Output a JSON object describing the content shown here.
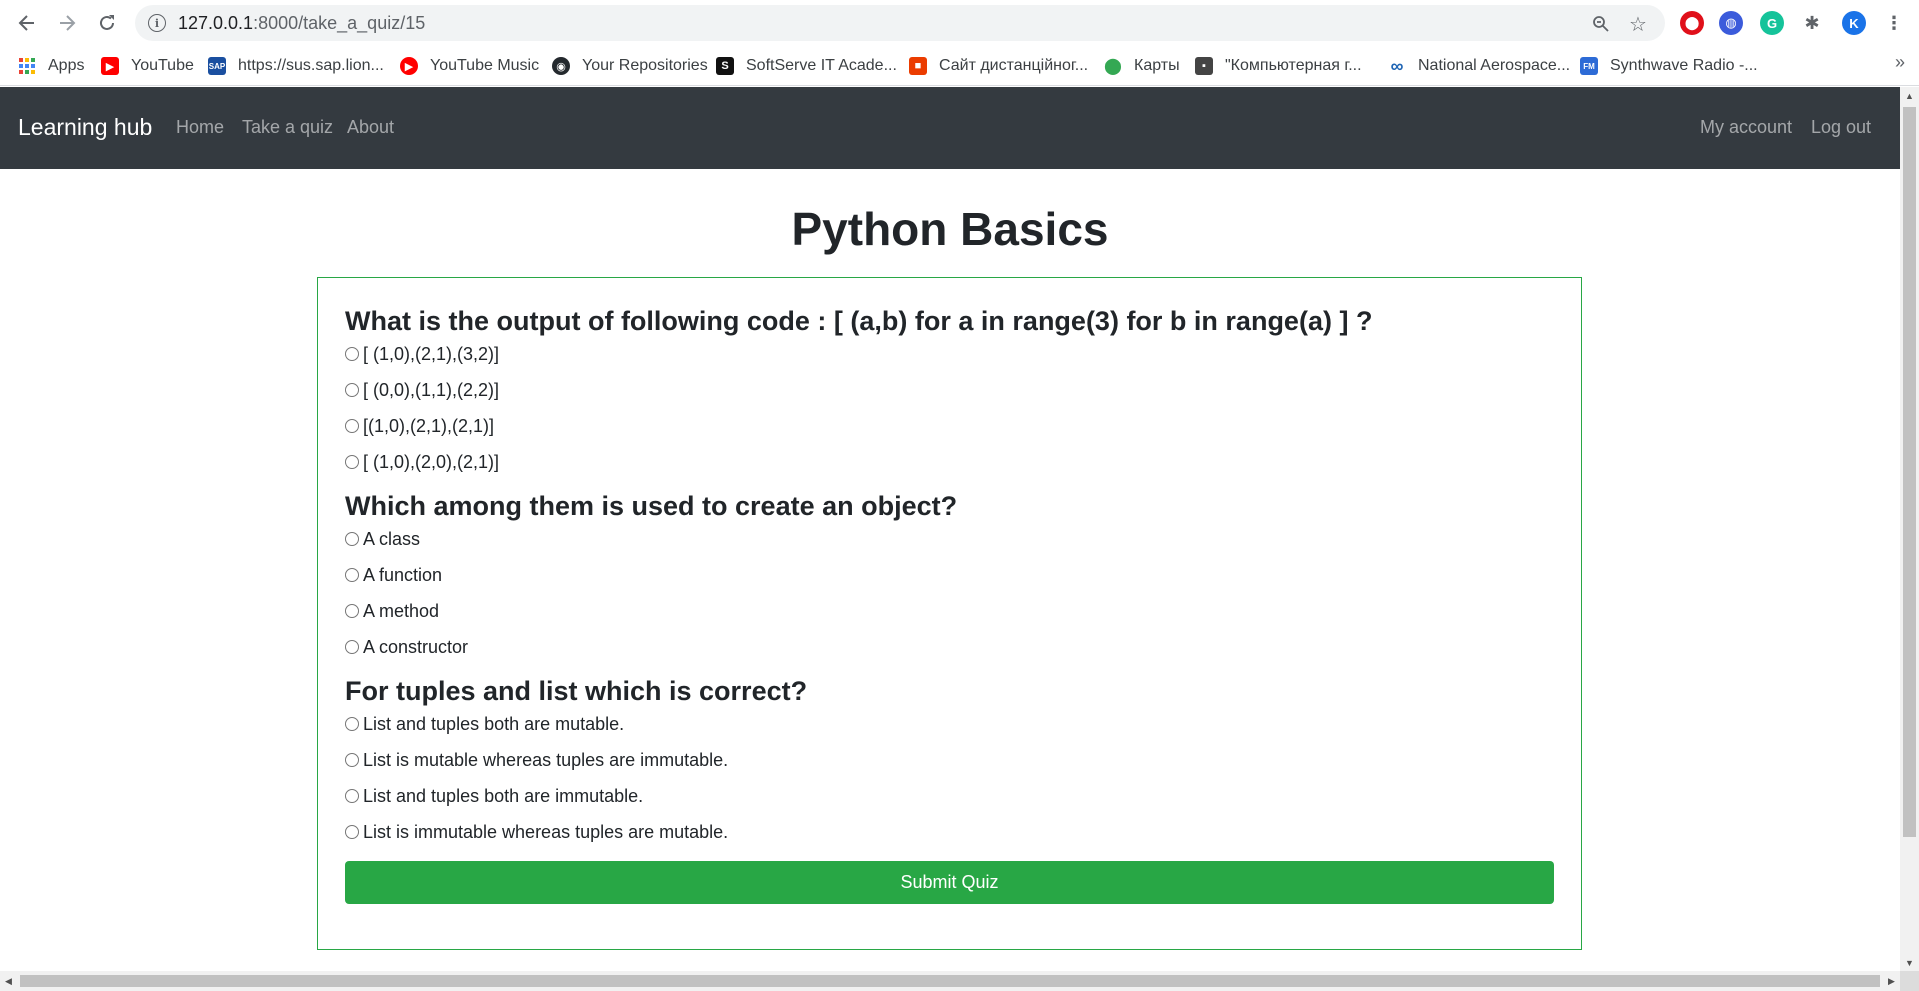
{
  "browser": {
    "url_host": "127.0.0.1",
    "url_rest": ":8000/take_a_quiz/15",
    "profile_initial": "K",
    "bookmarks": [
      {
        "label": "Apps",
        "icon": "apps-grid-icon",
        "color": "#4285f4"
      },
      {
        "label": "YouTube",
        "icon": "youtube-icon",
        "color": "#ff0000"
      },
      {
        "label": "https://sus.sap.lion...",
        "icon": "sap-icon",
        "color": "#1a4fa0"
      },
      {
        "label": "YouTube Music",
        "icon": "youtube-music-icon",
        "color": "#ff0000"
      },
      {
        "label": "Your Repositories",
        "icon": "github-icon",
        "color": "#24292e"
      },
      {
        "label": "SoftServe IT Acade...",
        "icon": "softserve-icon",
        "color": "#111111"
      },
      {
        "label": "Сайт дистанційног...",
        "icon": "office-icon",
        "color": "#eb3c00"
      },
      {
        "label": "Карты",
        "icon": "maps-pin-icon",
        "color": "#34a853"
      },
      {
        "label": "\"Компьютерная г...",
        "icon": "classroom-icon",
        "color": "#444444"
      },
      {
        "label": "National Aerospace...",
        "icon": "nau-infinity-icon",
        "color": "#1e64b4"
      },
      {
        "label": "Synthwave Radio -...",
        "icon": "radio-icon",
        "color": "#2d6bd6"
      }
    ]
  },
  "navbar": {
    "brand": "Learning hub",
    "links": [
      "Home",
      "Take a quiz",
      "About"
    ],
    "right_links": [
      "My account",
      "Log out"
    ]
  },
  "quiz": {
    "title": "Python Basics",
    "questions": [
      {
        "text": "What is the output of following code : [ (a,b) for a in range(3) for b in range(a) ] ?",
        "options": [
          "[ (1,0),(2,1),(3,2)]",
          "[ (0,0),(1,1),(2,2)]",
          "[(1,0),(2,1),(2,1)]",
          "[ (1,0),(2,0),(2,1)]"
        ]
      },
      {
        "text": "Which among them is used to create an object?",
        "options": [
          "A class",
          "A function",
          "A method",
          "A constructor"
        ]
      },
      {
        "text": "For tuples and list which is correct?",
        "options": [
          "List and tuples both are mutable.",
          "List is mutable whereas tuples are immutable.",
          "List and tuples both are immutable.",
          "List is immutable whereas tuples are mutable."
        ]
      }
    ],
    "submit_label": "Submit Quiz"
  },
  "colors": {
    "navbar_bg": "#343a40",
    "accent_green": "#28a745"
  }
}
